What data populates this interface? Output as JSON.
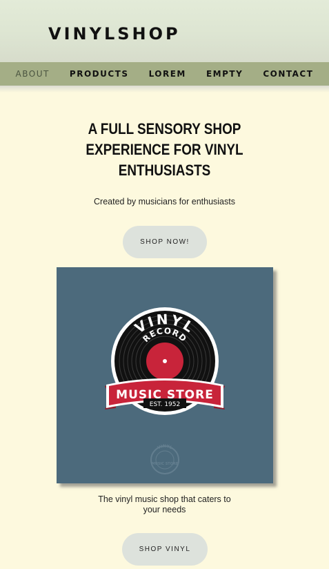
{
  "header": {
    "logo": "VINYLSHOP"
  },
  "nav": {
    "items": [
      {
        "label": "ABOUT",
        "active": true
      },
      {
        "label": "PRODUCTS",
        "active": false
      },
      {
        "label": "LOREM",
        "active": false
      },
      {
        "label": "EMPTY",
        "active": false
      },
      {
        "label": "CONTACT",
        "active": false
      }
    ]
  },
  "hero": {
    "headline_lines": [
      "A FULL SENSORY SHOP",
      "EXPERIENCE FOR VINYL",
      "ENTHUSIASTS"
    ],
    "tagline": "Created by musicians for enthusiasts",
    "cta_label": "SHOP NOW!"
  },
  "feature": {
    "image": {
      "badge_top": "VINYL",
      "badge_sub": "RECORD",
      "banner": "MUSIC STORE",
      "est": "EST. 1952",
      "watermark_top": "VINYL",
      "watermark_bottom": "MUSIC STORE"
    },
    "caption": "The vinyl music shop that caters to your needs",
    "cta_label": "SHOP VINYL"
  },
  "colors": {
    "page_bg": "#fdf9de",
    "header_bg": "#e3ebd8",
    "nav_bg": "#a4ae86",
    "button_bg": "#dde2dc",
    "card_bg": "#4c6a7c",
    "record_red": "#c8243a"
  }
}
